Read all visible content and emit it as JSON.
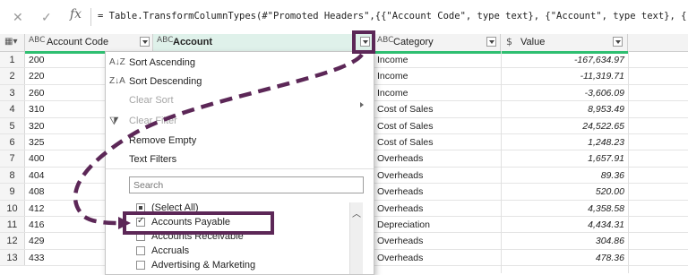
{
  "formula_bar": {
    "cancel_icon": "close-icon",
    "confirm_icon": "check-icon",
    "fx_label": "fx",
    "formula": "= Table.TransformColumnTypes(#\"Promoted Headers\",{{\"Account Code\", type text}, {\"Account\", type text}, {\"Category\""
  },
  "columns": {
    "table_icon": "table-icon",
    "account_code": {
      "type_icon": "ABC",
      "label": "Account Code"
    },
    "account": {
      "type_icon": "ABC",
      "label": "Account"
    },
    "category": {
      "type_icon": "ABC",
      "label": "Category"
    },
    "value": {
      "type_icon": "$",
      "label": "Value"
    }
  },
  "rows": [
    {
      "n": "1",
      "code": "200",
      "category": "Income",
      "value": "-167,634.97"
    },
    {
      "n": "2",
      "code": "220",
      "category": "Income",
      "value": "-11,319.71"
    },
    {
      "n": "3",
      "code": "260",
      "category": "Income",
      "value": "-3,606.09"
    },
    {
      "n": "4",
      "code": "310",
      "category": "Cost of Sales",
      "value": "8,953.49"
    },
    {
      "n": "5",
      "code": "320",
      "category": "Cost of Sales",
      "value": "24,522.65"
    },
    {
      "n": "6",
      "code": "325",
      "category": "Cost of Sales",
      "value": "1,248.23"
    },
    {
      "n": "7",
      "code": "400",
      "category": "Overheads",
      "value": "1,657.91"
    },
    {
      "n": "8",
      "code": "404",
      "category": "Overheads",
      "value": "89.36"
    },
    {
      "n": "9",
      "code": "408",
      "category": "Overheads",
      "value": "520.00"
    },
    {
      "n": "10",
      "code": "412",
      "category": "Overheads",
      "value": "4,358.58"
    },
    {
      "n": "11",
      "code": "416",
      "category": "Depreciation",
      "value": "4,434.31"
    },
    {
      "n": "12",
      "code": "429",
      "category": "Overheads",
      "value": "304.86"
    },
    {
      "n": "13",
      "code": "433",
      "category": "Overheads",
      "value": "478.36"
    }
  ],
  "menu": {
    "sort_ascending": "Sort Ascending",
    "sort_descending": "Sort Descending",
    "clear_sort": "Clear Sort",
    "clear_filter": "Clear Filter",
    "remove_empty": "Remove Empty",
    "text_filters": "Text Filters",
    "search_placeholder": "Search",
    "list": [
      {
        "label": "(Select All)",
        "state": "partial"
      },
      {
        "label": "Accounts Payable",
        "state": "checked"
      },
      {
        "label": "Accounts Receivable",
        "state": "unchecked"
      },
      {
        "label": "Accruals",
        "state": "unchecked"
      },
      {
        "label": "Advertising & Marketing",
        "state": "unchecked"
      }
    ]
  },
  "colors": {
    "highlight": "#5c2757",
    "selected_column": "#dff1ea",
    "accent_line": "#2fbf71"
  }
}
